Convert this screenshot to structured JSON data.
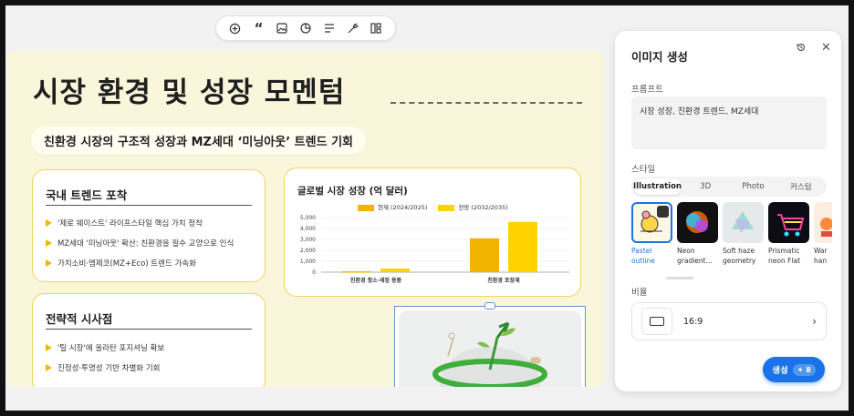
{
  "toolbar": {
    "icons": [
      "add-circle-icon",
      "quote-icon",
      "image-icon",
      "chart-pie-icon",
      "align-icon",
      "magic-icon",
      "layout-icon"
    ]
  },
  "slide": {
    "title": "시장 환경 및 성장 모멘텀",
    "subtitle": "친환경 시장의 구조적 성장과 MZ세대 ‘미닝아웃’ 트렌드 기회",
    "card_domestic": {
      "heading": "국내 트렌드 포착",
      "bullets": [
        "'제로 웨이스트' 라이프스타일 핵심 가치 정착",
        "MZ세대 '미닝아웃' 확산: 친환경을 필수 교양으로 인식",
        "가치소비·엠제코(MZ+Eco) 트렌드 가속화"
      ]
    },
    "card_strategy": {
      "heading": "전략적 시사점",
      "bullets": [
        "'틸 시장'에 올라탄 포지셔닝 확보",
        "진정성·투명성 기반 차별화 기회"
      ]
    },
    "chart_title": "글로벌 시장 성장 (억 달러)"
  },
  "chart_data": {
    "type": "bar",
    "title": "글로벌 시장 성장 (억 달러)",
    "categories": [
      "친환경 청소·세정 용품",
      "친환경 포장재"
    ],
    "series": [
      {
        "name": "현재 (2024/2025)",
        "values": [
          80,
          3100
        ],
        "color": "#f0b400"
      },
      {
        "name": "전망 (2032/2035)",
        "values": [
          320,
          4600
        ],
        "color": "#ffd200"
      }
    ],
    "y_ticks": [
      "5,000",
      "4,000",
      "3,000",
      "2,000",
      "1,000",
      "0"
    ],
    "ylim": [
      0,
      5000
    ],
    "grid": true,
    "legend": "top"
  },
  "panel": {
    "title": "이미지 생성",
    "prompt_label": "프롬프트",
    "prompt_text": "시장 성장, 친환경 트렌드, MZ세대",
    "style_label": "스타일",
    "tabs": [
      "Illustration",
      "3D",
      "Photo",
      "커스텀"
    ],
    "styles": [
      {
        "name": "Pastel\noutline",
        "selected": true
      },
      {
        "name": "Neon\ngradient...",
        "selected": false
      },
      {
        "name": "Soft haze\ngeometry",
        "selected": false
      },
      {
        "name": "Prismatic\nneon Flat",
        "selected": false
      },
      {
        "name": "War\nhan",
        "selected": false
      }
    ],
    "ratio_label": "비율",
    "ratio_value": "16:9",
    "generate_label": "생성",
    "generate_cost": "8",
    "accent": "#1a73e8"
  }
}
